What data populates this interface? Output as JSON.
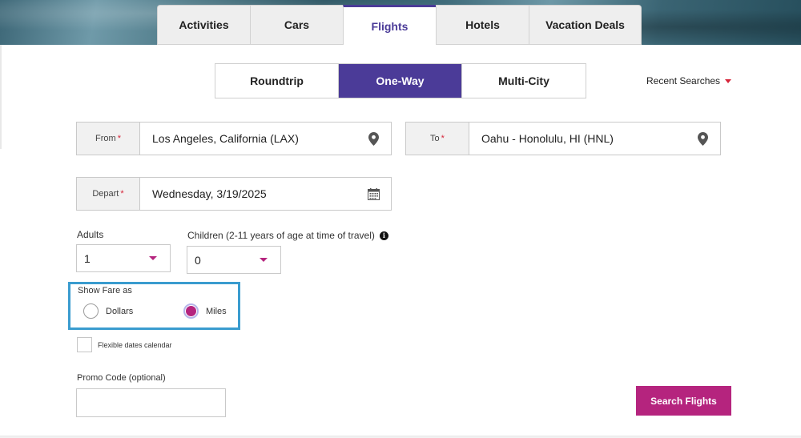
{
  "tabs": [
    {
      "label": "Activities"
    },
    {
      "label": "Cars"
    },
    {
      "label": "Flights",
      "active": true
    },
    {
      "label": "Hotels"
    },
    {
      "label": "Vacation Deals"
    }
  ],
  "trip_type": {
    "options": [
      {
        "label": "Roundtrip"
      },
      {
        "label": "One-Way",
        "active": true
      },
      {
        "label": "Multi-City"
      }
    ]
  },
  "recent_searches": {
    "label": "Recent Searches",
    "icon": "caret-down-icon"
  },
  "from": {
    "label": "From",
    "required_mark": "*",
    "value": "Los Angeles, California (LAX)",
    "icon": "map-pin-icon"
  },
  "to": {
    "label": "To",
    "required_mark": "*",
    "value": "Oahu - Honolulu, HI (HNL)",
    "icon": "map-pin-icon"
  },
  "depart": {
    "label": "Depart",
    "required_mark": "*",
    "value": "Wednesday, 3/19/2025",
    "icon": "calendar-icon"
  },
  "adults": {
    "label": "Adults",
    "value": "1"
  },
  "children": {
    "label": "Children (2-11 years of age at time of travel)",
    "value": "0",
    "icon": "info-icon"
  },
  "fare": {
    "title": "Show Fare as",
    "options": [
      {
        "label": "Dollars",
        "selected": false
      },
      {
        "label": "Miles",
        "selected": true
      }
    ]
  },
  "flexible_dates": {
    "label": "Flexible dates calendar",
    "checked": false
  },
  "promo": {
    "label": "Promo Code (optional)",
    "value": "",
    "placeholder": ""
  },
  "search_button": {
    "label": "Search Flights"
  },
  "colors": {
    "primary_purple": "#4b3b98",
    "accent_magenta": "#b5247e",
    "highlight_blue": "#3a9ccf",
    "required_red": "#d6263a"
  }
}
